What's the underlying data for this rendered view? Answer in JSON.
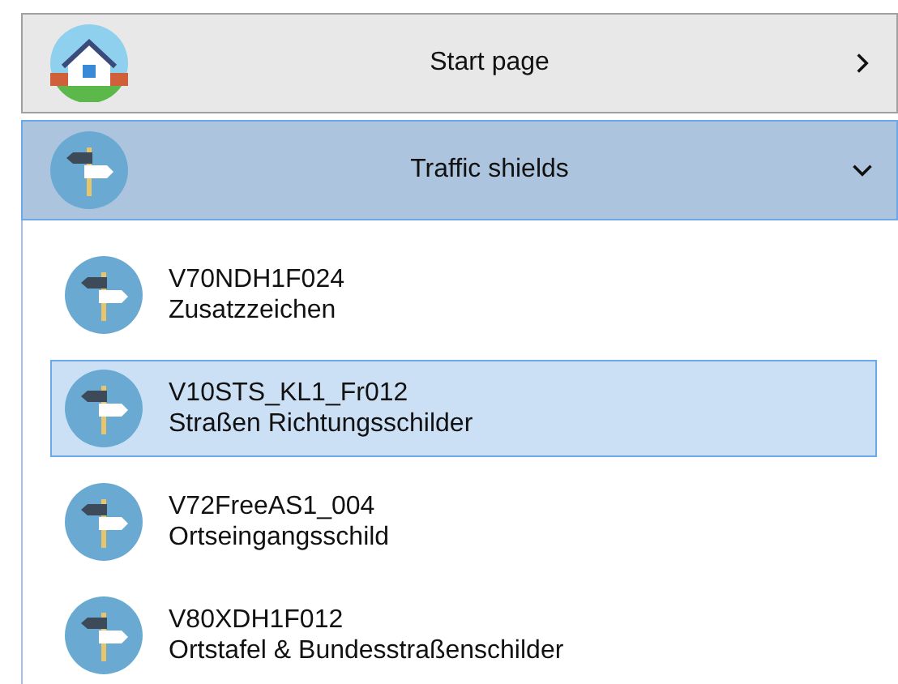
{
  "sections": [
    {
      "title": "Start page",
      "kind": "house",
      "selected": false,
      "expanded": false
    },
    {
      "title": "Traffic shields",
      "kind": "signpost",
      "selected": true,
      "expanded": true
    }
  ],
  "items": [
    {
      "name": "V70NDH1F024",
      "description": "Zusatzzeichen",
      "selected": false
    },
    {
      "name": "V10STS_KL1_Fr012",
      "description": "Straßen Richtungsschilder",
      "selected": true
    },
    {
      "name": "V72FreeAS1_004",
      "description": "Ortseingangsschild",
      "selected": false
    },
    {
      "name": "V80XDH1F012",
      "description": "Ortstafel & Bundesstraßenschilder",
      "selected": false
    }
  ]
}
